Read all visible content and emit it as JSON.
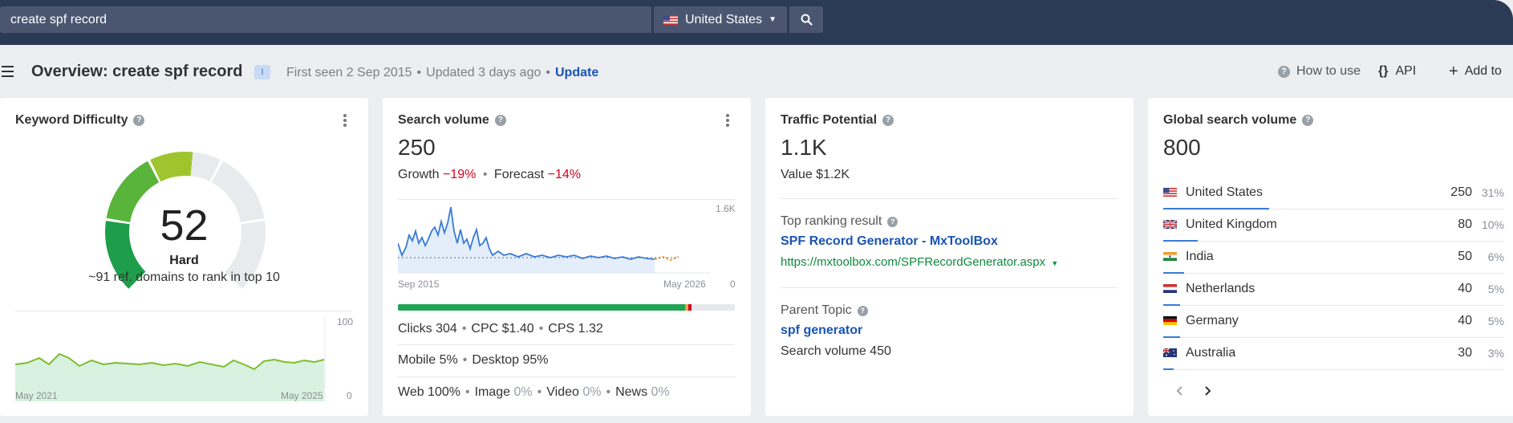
{
  "search": {
    "query": "create spf record",
    "country": "United States"
  },
  "header": {
    "title": "Overview: create spf record",
    "badge": "I",
    "first_seen": "First seen 2 Sep 2015",
    "updated": "Updated 3 days ago",
    "update_link": "Update",
    "how_to_use": "How to use",
    "api": "API",
    "add_to": "Add to"
  },
  "kd_card": {
    "title": "Keyword Difficulty",
    "value": "52",
    "difficulty": 52,
    "label": "Hard",
    "sub": "~91 ref. domains to rank in top 10",
    "chart_start": "May 2021",
    "chart_end": "May 2025",
    "axis_top": "100",
    "axis_bottom": "0"
  },
  "sv_card": {
    "title": "Search volume",
    "value": "250",
    "growth_label": "Growth",
    "growth": "−19%",
    "forecast_label": "Forecast",
    "forecast": "−14%",
    "axis_top": "1.6K",
    "axis_bottom": "0",
    "chart_start": "Sep 2015",
    "chart_end": "May 2026",
    "clicks": "Clicks 304",
    "cpc": "CPC $1.40",
    "cps": "CPS 1.32",
    "clicks_fraction": 0.87,
    "mobile": "Mobile 5%",
    "desktop": "Desktop 95%",
    "web": "Web 100%",
    "image_label": "Image",
    "image": "0%",
    "video_label": "Video",
    "video": "0%",
    "news_label": "News",
    "news": "0%"
  },
  "tp_card": {
    "title": "Traffic Potential",
    "value": "1.1K",
    "sub": "Value $1.2K",
    "top_result_label": "Top ranking result",
    "top_result_title": "SPF Record Generator - MxToolBox",
    "top_result_url": "https://mxtoolbox.com/SPFRecordGenerator.aspx",
    "parent_label": "Parent Topic",
    "parent_topic": "spf generator",
    "parent_volume": "Search volume 450"
  },
  "gsv_card": {
    "title": "Global search volume",
    "value": "800",
    "countries": [
      {
        "name": "United States",
        "value": "250",
        "pct": "31%",
        "share": 0.31
      },
      {
        "name": "United Kingdom",
        "value": "80",
        "pct": "10%",
        "share": 0.1
      },
      {
        "name": "India",
        "value": "50",
        "pct": "6%",
        "share": 0.06
      },
      {
        "name": "Netherlands",
        "value": "40",
        "pct": "5%",
        "share": 0.05
      },
      {
        "name": "Germany",
        "value": "40",
        "pct": "5%",
        "share": 0.05
      },
      {
        "name": "Australia",
        "value": "30",
        "pct": "3%",
        "share": 0.03
      }
    ]
  },
  "colors": {
    "topbar": "#2b3a55",
    "link": "#1a54b3",
    "negative": "#d0021b",
    "url": "#0d8a3e",
    "chart_line": "#3a7bd5",
    "kd_line": "#7dbd2e"
  }
}
